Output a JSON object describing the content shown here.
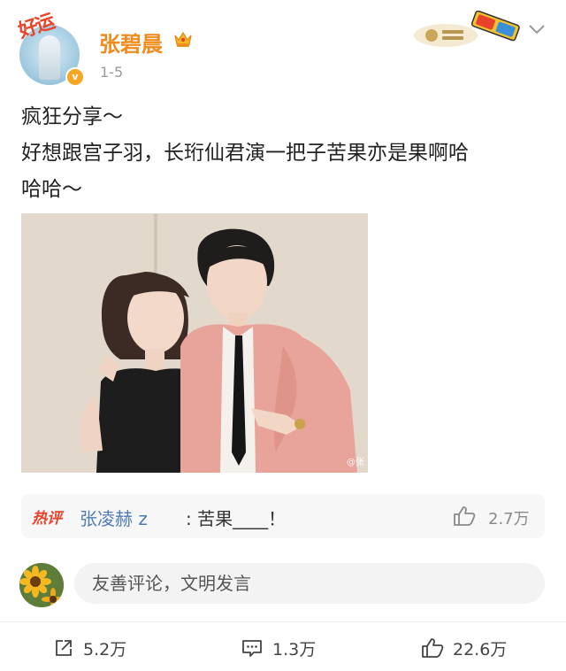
{
  "post": {
    "author": "张碧晨",
    "time": "1-5",
    "avatar_frame_text": "好运",
    "verified_mark": "v",
    "text_lines": [
      "疯狂分享～",
      "好想跟宫子羽，长珩仙君演一把子苦果亦是果啊哈",
      "哈哈～"
    ],
    "photo_watermark": "@张",
    "icons": {
      "crown": "crown-icon",
      "chevron": "chevron-down-icon",
      "decoration": "3d-glasses-badge"
    }
  },
  "hot_comment": {
    "tag": "热评",
    "author": "张凌赫 z",
    "text": ": 苦果____！",
    "like_count": "2.7万"
  },
  "comment_box": {
    "placeholder": "友善评论，文明发言"
  },
  "actions": {
    "repost_count": "5.2万",
    "comment_count": "1.3万",
    "like_count": "22.6万"
  },
  "colors": {
    "username": "#f08b1e",
    "hot_tag": "#e8412c",
    "link_blue": "#4f7ab5"
  }
}
